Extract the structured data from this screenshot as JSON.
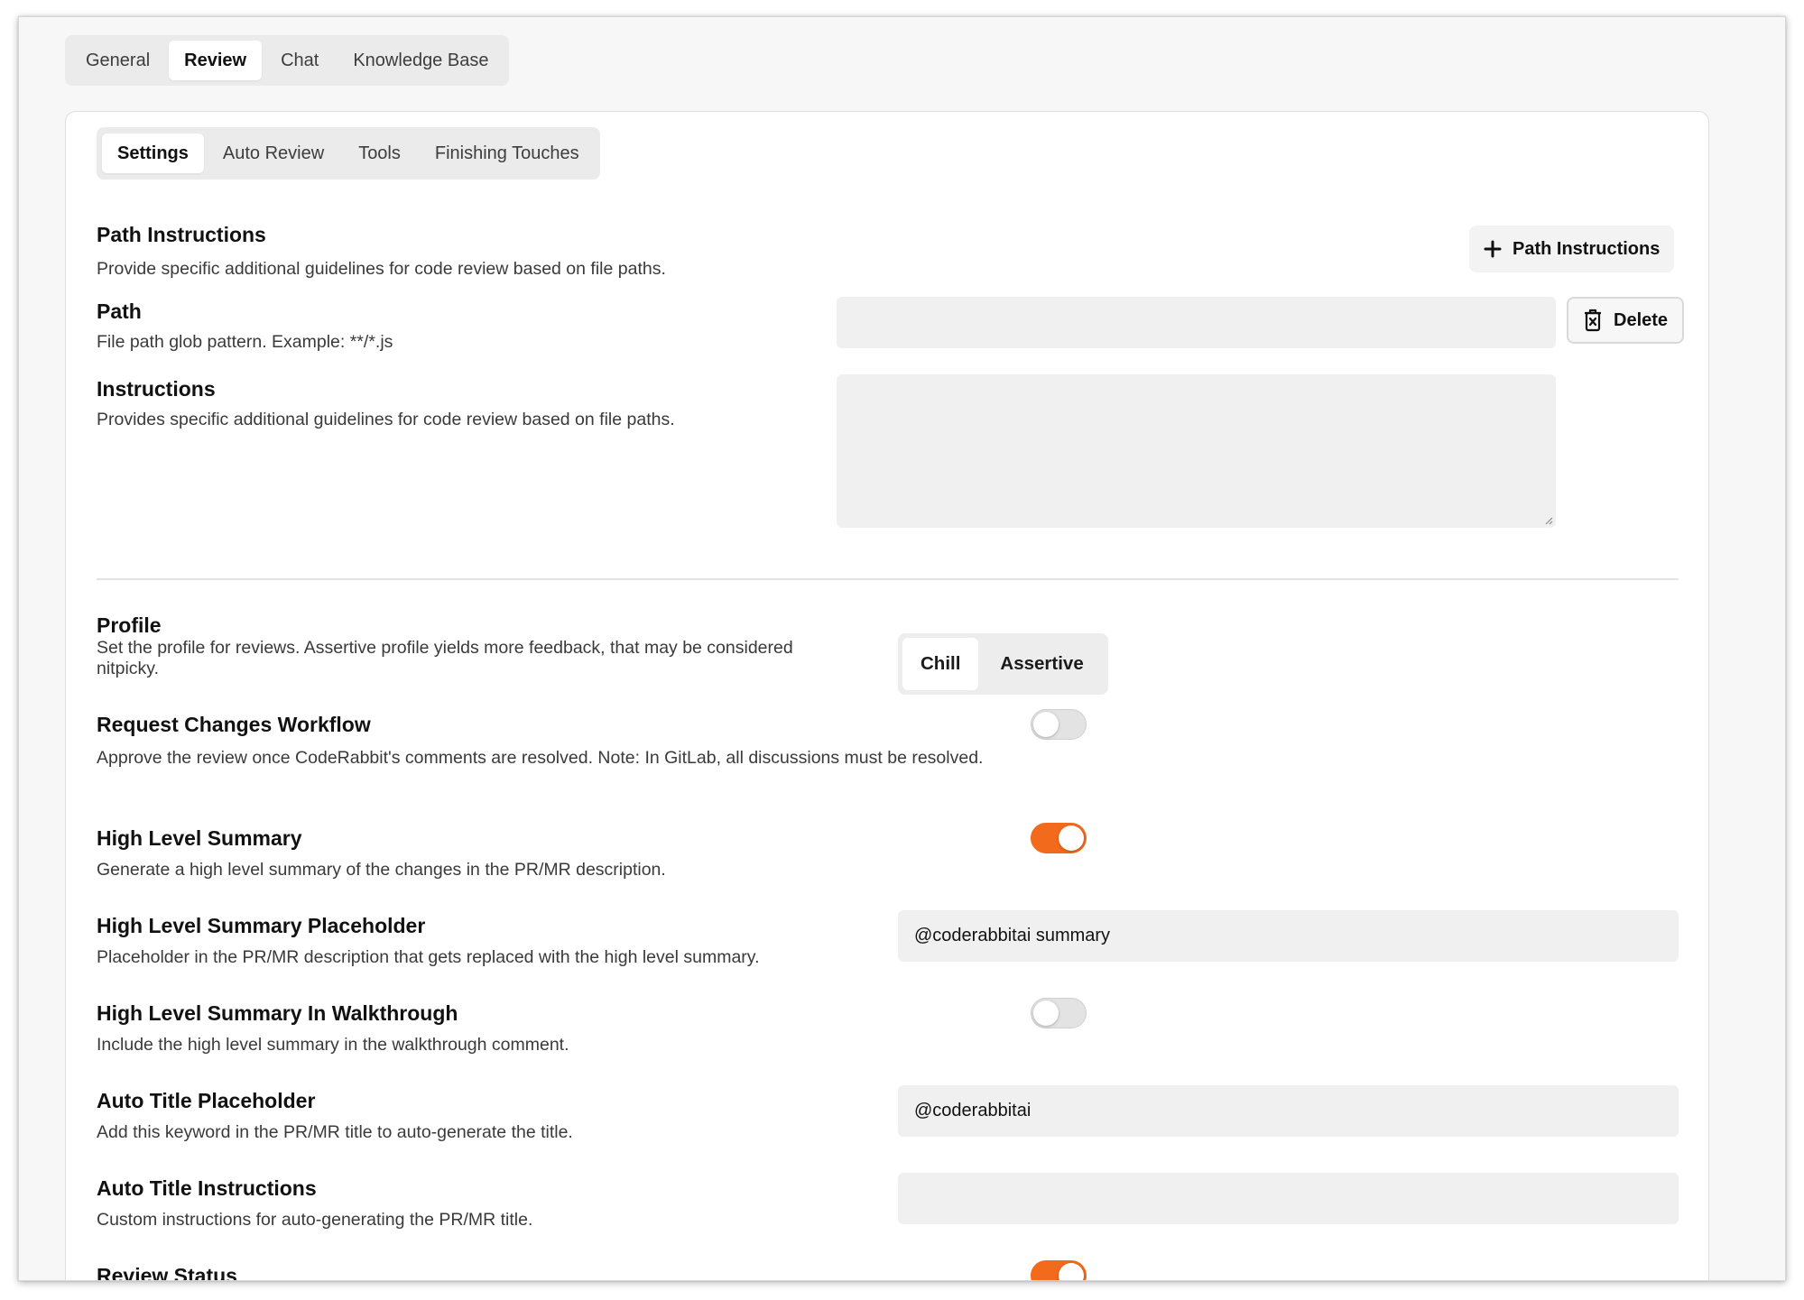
{
  "top_tabs": [
    {
      "label": "General",
      "active": false
    },
    {
      "label": "Review",
      "active": true
    },
    {
      "label": "Chat",
      "active": false
    },
    {
      "label": "Knowledge Base",
      "active": false
    }
  ],
  "sub_tabs": [
    {
      "label": "Settings",
      "active": true
    },
    {
      "label": "Auto Review",
      "active": false
    },
    {
      "label": "Tools",
      "active": false
    },
    {
      "label": "Finishing Touches",
      "active": false
    }
  ],
  "path_instructions": {
    "title": "Path Instructions",
    "description": "Provide specific additional guidelines for code review based on file paths.",
    "add_button_label": "Path Instructions",
    "path": {
      "title": "Path",
      "description": "File path glob pattern. Example: **/*.js",
      "value": ""
    },
    "delete_button_label": "Delete",
    "instructions": {
      "title": "Instructions",
      "description": "Provides specific additional guidelines for code review based on file paths.",
      "value": ""
    }
  },
  "profile": {
    "title": "Profile",
    "description": "Set the profile for reviews. Assertive profile yields more feedback, that may be considered nitpicky.",
    "options": [
      "Chill",
      "Assertive"
    ],
    "selected": "Chill"
  },
  "request_changes_workflow": {
    "title": "Request Changes Workflow",
    "description": "Approve the review once CodeRabbit's comments are resolved. Note: In GitLab, all discussions must be resolved.",
    "enabled": false
  },
  "high_level_summary": {
    "title": "High Level Summary",
    "description": "Generate a high level summary of the changes in the PR/MR description.",
    "enabled": true
  },
  "high_level_summary_placeholder": {
    "title": "High Level Summary Placeholder",
    "description": "Placeholder in the PR/MR description that gets replaced with the high level summary.",
    "value": "@coderabbitai summary"
  },
  "high_level_summary_in_walkthrough": {
    "title": "High Level Summary In Walkthrough",
    "description": "Include the high level summary in the walkthrough comment.",
    "enabled": false
  },
  "auto_title_placeholder": {
    "title": "Auto Title Placeholder",
    "description": "Add this keyword in the PR/MR title to auto-generate the title.",
    "value": "@coderabbitai"
  },
  "auto_title_instructions": {
    "title": "Auto Title Instructions",
    "description": "Custom instructions for auto-generating the PR/MR title.",
    "value": ""
  },
  "review_status": {
    "title": "Review Status",
    "enabled": true
  },
  "colors": {
    "accent_orange": "#f26b1d",
    "input_bg": "#f0f0f0",
    "tabbar_bg": "#ebebeb"
  }
}
